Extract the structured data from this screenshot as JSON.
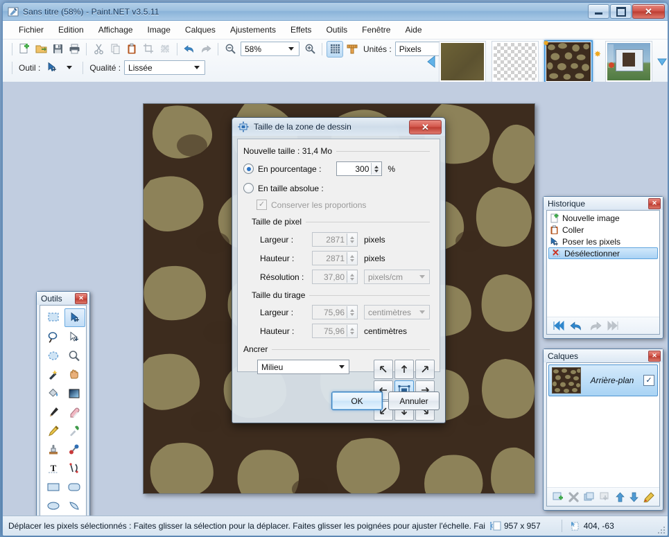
{
  "window": {
    "title": "Sans titre (58%) - Paint.NET v3.5.11",
    "icon": "paintnet-icon",
    "buttons": {
      "minimize": "minimize-button",
      "maximize": "maximize-button",
      "close": "close-button",
      "close_glyph": "✕"
    }
  },
  "menu": {
    "items": [
      {
        "label": "Fichier",
        "name": "menu-fichier"
      },
      {
        "label": "Edition",
        "name": "menu-edition"
      },
      {
        "label": "Affichage",
        "name": "menu-affichage"
      },
      {
        "label": "Image",
        "name": "menu-image"
      },
      {
        "label": "Calques",
        "name": "menu-calques"
      },
      {
        "label": "Ajustements",
        "name": "menu-ajustements"
      },
      {
        "label": "Effets",
        "name": "menu-effets"
      },
      {
        "label": "Outils",
        "name": "menu-outils"
      },
      {
        "label": "Fenêtre",
        "name": "menu-fenetre"
      },
      {
        "label": "Aide",
        "name": "menu-aide"
      }
    ]
  },
  "toolbar": {
    "icons": [
      "new-icon",
      "open-icon",
      "save-icon",
      "print-icon",
      "cut-icon",
      "copy-icon",
      "paste-icon",
      "crop-icon",
      "deselect-icon",
      "undo-icon",
      "redo-icon"
    ],
    "zoom_out_icon": "zoom-out-icon",
    "zoom_in_icon": "zoom-in-icon",
    "zoom_value": "58%",
    "grid_icon": "grid-icon",
    "ruler_icon": "ruler-icon",
    "units_label": "Unités :",
    "units_value": "Pixels",
    "tool_label": "Outil :",
    "tool_icon": "move-selected-pixels-icon",
    "quality_label": "Qualité :",
    "quality_value": "Lissée"
  },
  "thumbnails": {
    "items": [
      {
        "name": "thumbnail-olive-image",
        "selected": false
      },
      {
        "name": "thumbnail-transparent-image",
        "selected": false
      },
      {
        "name": "thumbnail-camo-image",
        "selected": true
      },
      {
        "name": "thumbnail-desktop-screenshot",
        "selected": false
      }
    ]
  },
  "tools_palette": {
    "title": "Outils",
    "close_glyph": "✕",
    "tools": [
      {
        "name": "rectangle-select-tool",
        "glyph": "▫",
        "selected": false
      },
      {
        "name": "move-selected-pixels-tool",
        "glyph": "➤",
        "selected": true
      },
      {
        "name": "lasso-select-tool",
        "glyph": "◯",
        "selected": false
      },
      {
        "name": "move-selection-tool",
        "glyph": "▷",
        "selected": false
      },
      {
        "name": "ellipse-select-tool",
        "glyph": "◌",
        "selected": false
      },
      {
        "name": "zoom-tool",
        "glyph": "🔍",
        "selected": false
      },
      {
        "name": "magic-wand-tool",
        "glyph": "✨",
        "selected": false
      },
      {
        "name": "pan-tool",
        "glyph": "✋",
        "selected": false
      },
      {
        "name": "paint-bucket-tool",
        "glyph": "▰",
        "selected": false
      },
      {
        "name": "gradient-tool",
        "glyph": "▣",
        "selected": false
      },
      {
        "name": "paintbrush-tool",
        "glyph": "✎",
        "selected": false
      },
      {
        "name": "eraser-tool",
        "glyph": "▭",
        "selected": false
      },
      {
        "name": "pencil-tool",
        "glyph": "✏",
        "selected": false
      },
      {
        "name": "color-picker-tool",
        "glyph": "⌁",
        "selected": false
      },
      {
        "name": "clone-stamp-tool",
        "glyph": "⊥",
        "selected": false
      },
      {
        "name": "recolor-tool",
        "glyph": "⚭",
        "selected": false
      },
      {
        "name": "text-tool",
        "glyph": "T",
        "selected": false
      },
      {
        "name": "line-curve-tool",
        "glyph": "\\|2",
        "selected": false
      },
      {
        "name": "rectangle-shape-tool",
        "glyph": "▭",
        "selected": false
      },
      {
        "name": "rounded-rectangle-shape-tool",
        "glyph": "▢",
        "selected": false
      },
      {
        "name": "ellipse-shape-tool",
        "glyph": "◯",
        "selected": false
      },
      {
        "name": "freeform-shape-tool",
        "glyph": "◗",
        "selected": false
      }
    ]
  },
  "history_palette": {
    "title": "Historique",
    "close_glyph": "✕",
    "items": [
      {
        "label": "Nouvelle image",
        "icon": "new-image-icon",
        "selected": false
      },
      {
        "label": "Coller",
        "icon": "paste-icon",
        "selected": false
      },
      {
        "label": "Poser les pixels",
        "icon": "finish-pixels-icon",
        "selected": false
      },
      {
        "label": "Désélectionner",
        "icon": "deselect-icon",
        "selected": true
      }
    ],
    "toolbar": [
      {
        "name": "history-rewind-all-button",
        "glyph": "⏮",
        "enabled": true
      },
      {
        "name": "history-undo-button",
        "glyph": "↩",
        "enabled": true
      },
      {
        "name": "history-redo-button",
        "glyph": "↪",
        "enabled": false
      },
      {
        "name": "history-forward-all-button",
        "glyph": "⏭",
        "enabled": false
      }
    ]
  },
  "layers_palette": {
    "title": "Calques",
    "close_glyph": "✕",
    "layers": [
      {
        "name": "Arrière-plan",
        "visible": true,
        "check_glyph": "✓",
        "selected": true
      }
    ],
    "toolbar": [
      {
        "name": "add-layer-button",
        "glyph": "＋",
        "enabled": true
      },
      {
        "name": "delete-layer-button",
        "glyph": "✖",
        "enabled": true
      },
      {
        "name": "duplicate-layer-button",
        "glyph": "❐",
        "enabled": true
      },
      {
        "name": "merge-layer-down-button",
        "glyph": "⤓",
        "enabled": false
      },
      {
        "name": "move-layer-up-button",
        "glyph": "⬆",
        "enabled": true
      },
      {
        "name": "move-layer-down-button",
        "glyph": "⬇",
        "enabled": true
      },
      {
        "name": "layer-properties-button",
        "glyph": "✎",
        "enabled": true
      }
    ]
  },
  "dialog": {
    "title": "Taille de la zone de dessin",
    "icon": "canvas-size-icon",
    "close_glyph": "✕",
    "new_size_label": "Nouvelle taille : 31,4 Mo",
    "percentage": {
      "label": "En pourcentage :",
      "selected": true,
      "value": "300",
      "unit": "%"
    },
    "absolute": {
      "label": "En taille absolue :",
      "selected": false
    },
    "maintain_aspect": {
      "label": "Conserver les proportions",
      "checked": true,
      "check_glyph": "✓",
      "disabled": true
    },
    "pixel_size": {
      "group_label": "Taille de pixel",
      "width_label": "Largeur :",
      "width_value": "2871",
      "width_unit": "pixels",
      "height_label": "Hauteur :",
      "height_value": "2871",
      "height_unit": "pixels",
      "resolution_label": "Résolution :",
      "resolution_value": "37,80",
      "resolution_unit": "pixels/cm"
    },
    "print_size": {
      "group_label": "Taille du tirage",
      "width_label": "Largeur :",
      "width_value": "75,96",
      "width_unit": "centimètres",
      "height_label": "Hauteur :",
      "height_value": "75,96",
      "height_unit": "centimètres"
    },
    "anchor": {
      "group_label": "Ancrer",
      "value": "Milieu",
      "buttons": [
        {
          "name": "anchor-top-left-button",
          "glyph": "↖",
          "selected": false
        },
        {
          "name": "anchor-top-center-button",
          "glyph": "↑",
          "selected": false
        },
        {
          "name": "anchor-top-right-button",
          "glyph": "↗",
          "selected": false
        },
        {
          "name": "anchor-middle-left-button",
          "glyph": "←",
          "selected": false
        },
        {
          "name": "anchor-center-button",
          "glyph": "▣",
          "selected": true
        },
        {
          "name": "anchor-middle-right-button",
          "glyph": "→",
          "selected": false
        },
        {
          "name": "anchor-bottom-left-button",
          "glyph": "↙",
          "selected": false
        },
        {
          "name": "anchor-bottom-center-button",
          "glyph": "↓",
          "selected": false
        },
        {
          "name": "anchor-bottom-right-button",
          "glyph": "↘",
          "selected": false
        }
      ]
    },
    "ok_label": "OK",
    "cancel_label": "Annuler"
  },
  "statusbar": {
    "help_text": "Déplacer les pixels sélectionnés : Faites glisser la sélection pour la déplacer. Faites glisser les poignées pour ajuster l'échelle. Fai",
    "size_icon": "image-size-icon",
    "size_text": "957 x 957",
    "cursor_icon": "cursor-position-icon",
    "cursor_text": "404, -63"
  },
  "colors": {
    "accent": "#4a9ada",
    "canvas_dark": "#3d2c1e",
    "canvas_light": "#8d8259",
    "titlebar": "#9cc0e0",
    "workspace": "#c1cde0"
  }
}
